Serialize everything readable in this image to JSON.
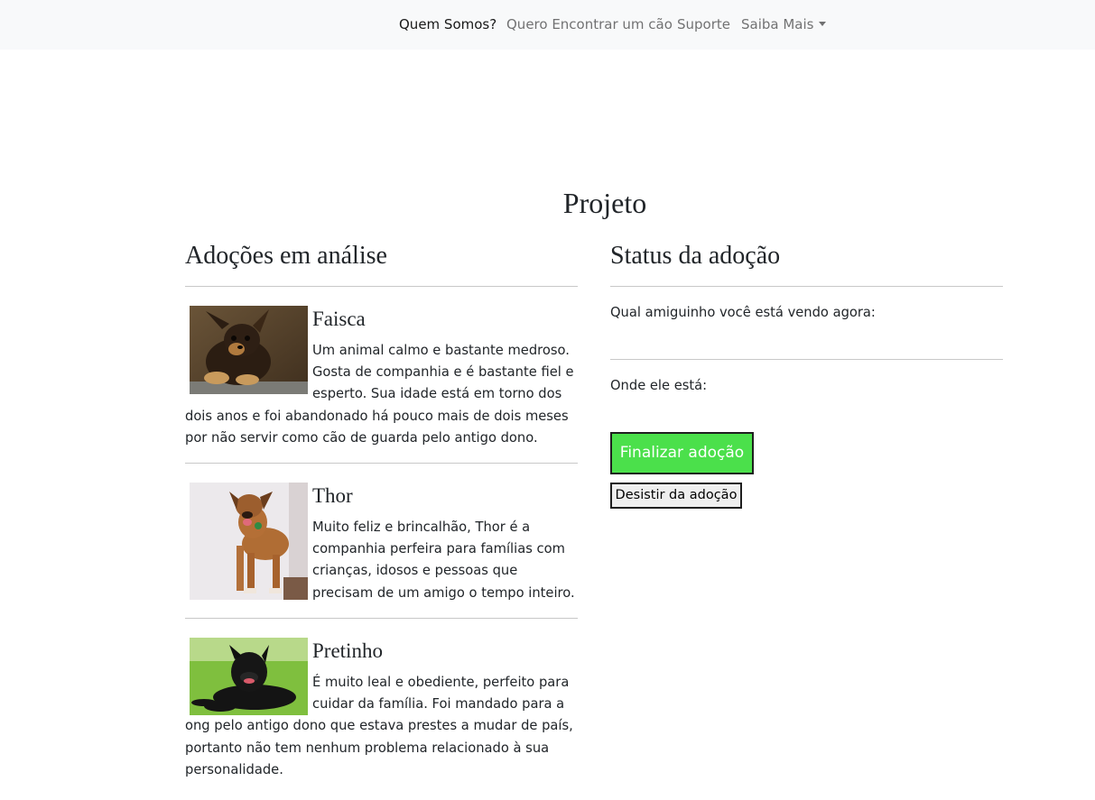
{
  "navbar": {
    "links": [
      {
        "label": "Quem Somos?"
      },
      {
        "label": "Quero Encontrar um cão"
      },
      {
        "label": "Suporte"
      },
      {
        "label": "Saiba Mais"
      }
    ]
  },
  "page": {
    "title": "Projeto"
  },
  "left": {
    "title": "Adoções em análise",
    "items": [
      {
        "name": "Faisca",
        "image": "dog-photo-faisca",
        "description": "Um animal calmo e bastante medroso. Gosta de companhia e é bastante fiel e esperto. Sua idade está em torno dos dois anos e foi abandonado há pouco mais de dois meses por não servir como cão de guarda pelo antigo dono."
      },
      {
        "name": "Thor",
        "image": "dog-photo-thor",
        "description": "Muito feliz e brincalhão, Thor é a companhia perfeira para famílias com crianças, idosos e pessoas que precisam de um amigo o tempo inteiro."
      },
      {
        "name": "Pretinho",
        "image": "dog-photo-pretinho",
        "description": "É muito leal e obediente, perfeito para cuidar da família. Foi mandado para a ong pelo antigo dono que estava prestes a mudar de país, portanto não tem nenhum problema relacionado à sua personalidade."
      }
    ]
  },
  "right": {
    "title": "Status da adoção",
    "current_label": "Qual amiguinho você está vendo agora:",
    "location_label": "Onde ele está:",
    "finalize_button": "Finalizar adoção",
    "quit_button": "Desistir da adoção"
  },
  "colors": {
    "navbar_bg": "#f8f9fa",
    "finalize_bg": "#4be04b",
    "divider": "#c8c8c8"
  }
}
